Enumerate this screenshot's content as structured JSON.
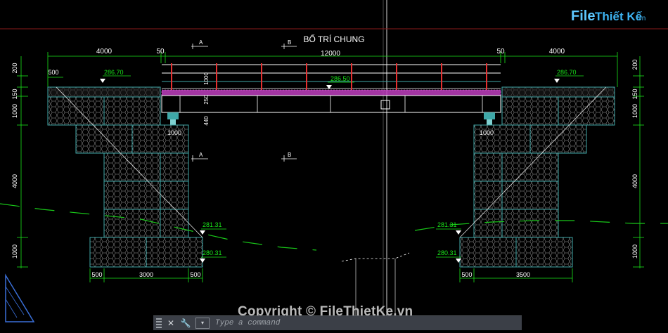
{
  "drawing": {
    "title": "BỐ TRÍ CHUNG",
    "section_marks": [
      "A",
      "B"
    ],
    "dimensions": {
      "span": "12000",
      "left_approach": "4000",
      "right_approach": "4000",
      "gap_left": "50",
      "gap_right": "50",
      "offset_500": "500",
      "bearing_width": "1000",
      "base_left_width": "3000",
      "base_right_width": "3500",
      "side_200": "200",
      "side_150": "150",
      "side_1000": "1000",
      "side_4000": "4000",
      "railing_1000": "1000",
      "deck_250": "250",
      "beam_440": "440"
    },
    "elevations": {
      "left_top": "286.70",
      "right_top": "286.70",
      "deck_top": "286.50",
      "left_mid": "281.31",
      "left_bottom": "280.31",
      "right_mid": "281.31",
      "right_bottom": "280.31"
    },
    "colors": {
      "dimension": "#19e519",
      "structure": "#ffffff",
      "gabion": "#3fa8a8",
      "railing_post": "#e53030",
      "deck_hatch": "#c040c0",
      "ground": "#19c819"
    }
  },
  "watermark": {
    "logo_file": "File",
    "logo_rest": "Thiết Kế",
    "logo_domain": ".vn",
    "copyright": "Copyright © FileThietKe.vn"
  },
  "command_line": {
    "placeholder": "Type a command",
    "close_icon": "close-icon",
    "wrench_icon": "wrench-icon"
  }
}
